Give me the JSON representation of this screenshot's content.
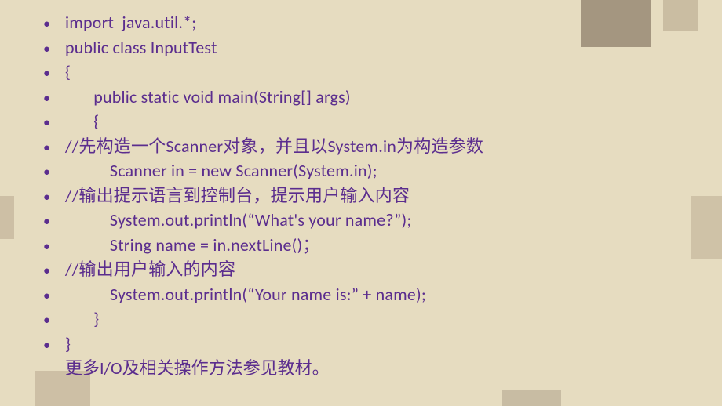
{
  "lines": [
    "import  java.util.*;",
    "public class InputTest",
    "{",
    "       public static void main(String[] args)",
    "       {",
    "//先构造一个Scanner对象，并且以System.in为构造参数",
    "           Scanner in = new Scanner(System.in);",
    "//输出提示语言到控制台，提示用户输入内容",
    "           System.out.println(“What's your name?”);",
    "           String name = in.nextLine()；",
    "//输出用户输入的内容",
    "           System.out.println(“Your name is:” + name);",
    "       }",
    "}"
  ],
  "footer": "更多I/O及相关操作方法参见教材。"
}
